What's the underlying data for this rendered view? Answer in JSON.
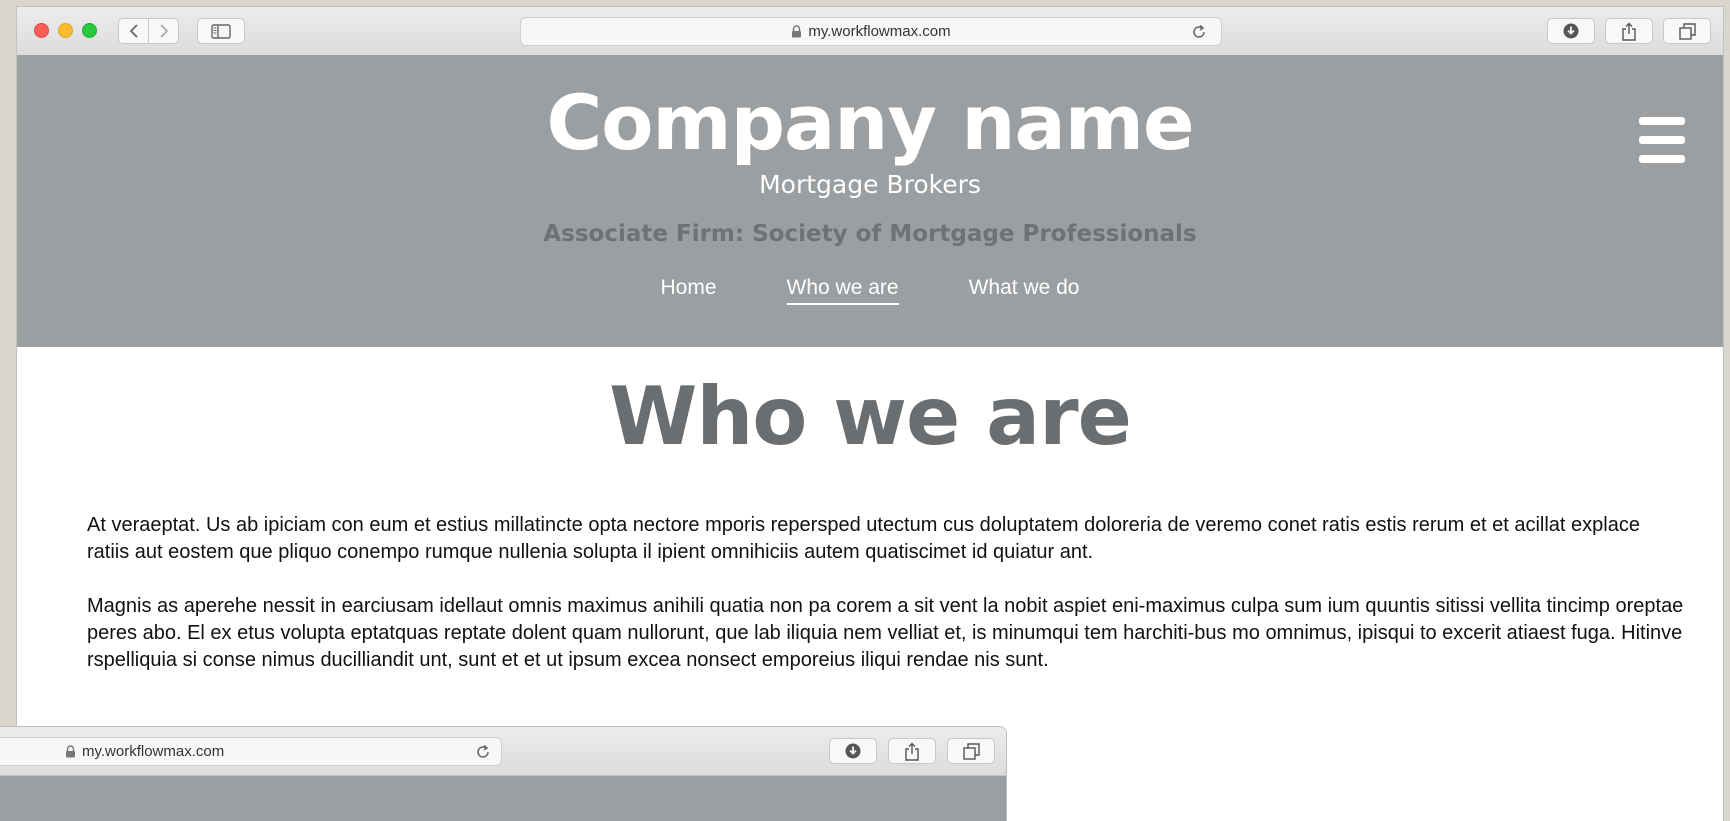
{
  "browser": {
    "url": "my.workflowmax.com",
    "icons": [
      "back-icon",
      "forward-icon",
      "sidebar-icon",
      "lock-icon",
      "reload-icon",
      "download-icon",
      "share-icon",
      "tabs-icon"
    ]
  },
  "header": {
    "company": "Company name",
    "tagline": "Mortgage Brokers",
    "associate": "Associate Firm: Society of Mortgage Professionals",
    "nav": [
      "Home",
      "Who we are",
      "What we do"
    ],
    "active_nav": "Who we are",
    "menu_icon": "hamburger-menu-icon"
  },
  "main": {
    "title": "Who we are",
    "paragraphs": [
      "At veraeptat. Us ab ipiciam con eum et estius millatincte opta nectore mporis repersped utectum cus doluptatem doloreria de veremo conet ratis estis rerum et et acillat explace ratiis aut eostem que pliquo conempo rumque nullenia solupta il ipient omnihiciis autem quatiscimet id quiatur ant.",
      "Magnis as aperehe nessit in earciusam idellaut omnis maximus anihili quatia non pa corem a sit vent la nobit aspiet eni-maximus culpa sum ium quuntis sitissi vellita tincimp oreptae peres abo. El ex etus volupta eptatquas reptate dolent quam nullorunt, que lab iliquia nem velliat et, is minumqui tem harchiti-bus mo omnimus, ipisqui to excerit atiaest fuga. Hitinve rspelliquia si conse nimus ducilliandit unt, sunt et et ut ipsum excea nonsect emporeius iliqui rendae nis sunt."
    ]
  },
  "second_window": {
    "url": "my.workflowmax.com"
  },
  "colors": {
    "header_bg": "#9b9fa2",
    "title_gray": "#6a6e70",
    "associate_gray": "#6e7274"
  }
}
